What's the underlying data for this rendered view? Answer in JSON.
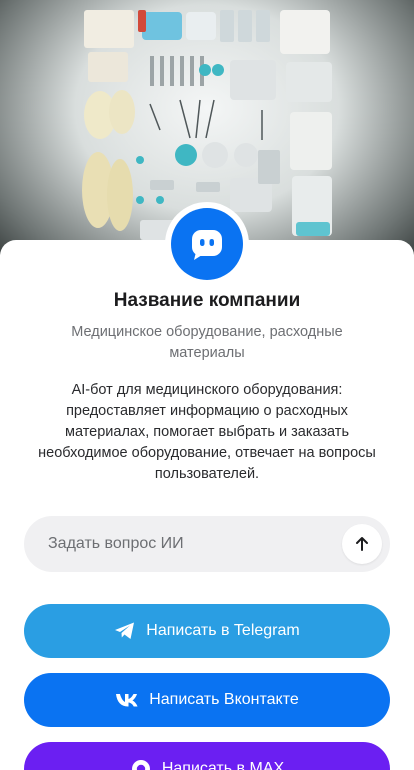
{
  "company": {
    "name": "Название компании",
    "category": "Медицинское оборудование, расходные материалы",
    "description": "AI-бот для медицинского оборудования: предоставляет информацию о расходных материалах, помогает выбрать и заказать необходимое оборудование, отвечает на вопросы пользователей."
  },
  "ask": {
    "placeholder": "Задать вопрос ИИ"
  },
  "buttons": {
    "telegram": "Написать в Telegram",
    "vk": "Написать Вконтакте",
    "max": "Написать в MAX"
  },
  "icons": {
    "avatar": "bot-face-icon",
    "send": "arrow-up-icon",
    "telegram": "telegram-icon",
    "vk": "vk-icon",
    "max": "max-icon"
  },
  "colors": {
    "avatar": "#0a73f2",
    "telegram": "#2a9ee3",
    "vk": "#0a73f2",
    "max": "#6b1ff2"
  }
}
